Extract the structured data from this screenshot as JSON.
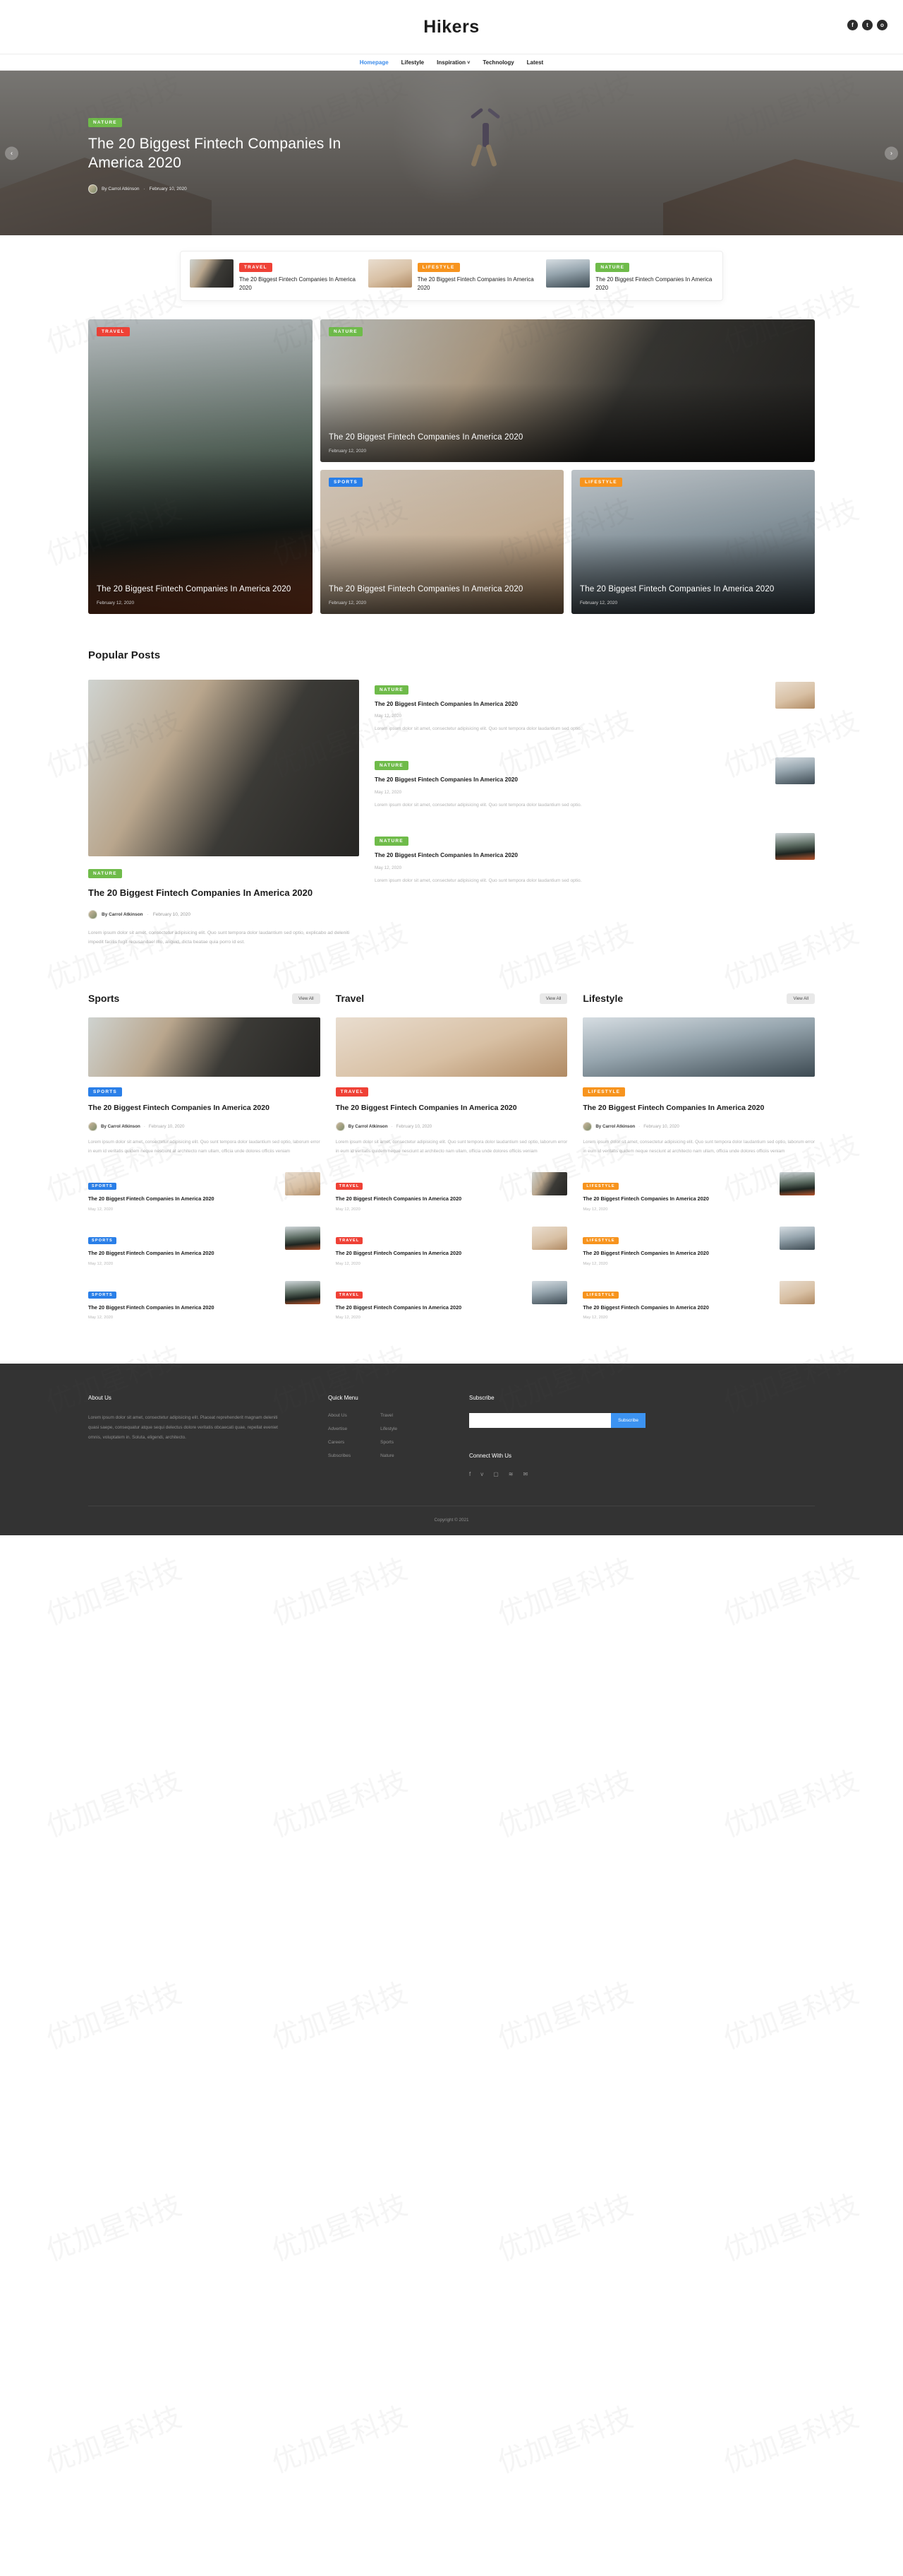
{
  "header": {
    "logo": "Hikers",
    "social_top": [
      {
        "name": "facebook-icon",
        "glyph": "f"
      },
      {
        "name": "twitter-icon",
        "glyph": "t"
      },
      {
        "name": "instagram-icon",
        "glyph": "o"
      }
    ],
    "nav": [
      {
        "label": "Homepage",
        "active": true
      },
      {
        "label": "Lifestyle",
        "active": false
      },
      {
        "label": "Inspiration",
        "active": false,
        "caret": "˅"
      },
      {
        "label": "Technology",
        "active": false
      },
      {
        "label": "Latest",
        "active": false
      }
    ]
  },
  "hero": {
    "badge": "NATURE",
    "title": "The 20 Biggest Fintech Companies In America 2020",
    "author": "By Carrol Atkinson",
    "separator": "·",
    "date": "February 10, 2020",
    "prev": "‹",
    "next": "›"
  },
  "strip": [
    {
      "badge": "TRAVEL",
      "badge_class": "b-travel",
      "title": "The 20 Biggest Fintech Companies In America 2020",
      "thumb": "t-office"
    },
    {
      "badge": "LIFESTYLE",
      "badge_class": "b-lifestyle",
      "title": "The 20 Biggest Fintech Companies In America 2020",
      "thumb": "t-jump"
    },
    {
      "badge": "NATURE",
      "badge_class": "b-nature",
      "title": "The 20 Biggest Fintech Companies In America 2020",
      "thumb": "t-cliff"
    }
  ],
  "featured": {
    "big": {
      "badge": "TRAVEL",
      "title": "The 20 Biggest Fintech Companies In America 2020",
      "date": "February 12, 2020"
    },
    "wide": {
      "badge": "NATURE",
      "title": "The 20 Biggest Fintech Companies In America 2020",
      "date": "February 12, 2020"
    },
    "small1": {
      "badge": "SPORTS",
      "title": "The 20 Biggest Fintech Companies In America 2020",
      "date": "February 12, 2020"
    },
    "small2": {
      "badge": "LIFESTYLE",
      "title": "The 20 Biggest Fintech Companies In America 2020",
      "date": "February 12, 2020"
    }
  },
  "popular": {
    "heading": "Popular Posts",
    "main": {
      "badge": "NATURE",
      "title": "The 20 Biggest Fintech Companies In America 2020",
      "author": "By Carrol Atkinson",
      "date": "February 10, 2020",
      "excerpt": "Lorem ipsum dolor sit amet, consectetur adipisicing elit. Quo sunt tempora dolor laudantium sed optio, explicabo ad deleniti impedit facilis fugit recusandae! Illo, aliquid, dicta beatae quia porro id est."
    },
    "items": [
      {
        "badge": "NATURE",
        "title": "The 20 Biggest Fintech Companies In America 2020",
        "date": "May 12, 2020",
        "excerpt": "Lorem ipsum dolor sit amet, consectetur adipisicing elit. Quo sunt tempora dolor laudantium sed optio.",
        "thumb": "t-jump"
      },
      {
        "badge": "NATURE",
        "title": "The 20 Biggest Fintech Companies In America 2020",
        "date": "May 12, 2020",
        "excerpt": "Lorem ipsum dolor sit amet, consectetur adipisicing elit. Quo sunt tempora dolor laudantium sed optio.",
        "thumb": "t-cliff"
      },
      {
        "badge": "NATURE",
        "title": "The 20 Biggest Fintech Companies In America 2020",
        "date": "May 12, 2020",
        "excerpt": "Lorem ipsum dolor sit amet, consectetur adipisicing elit. Quo sunt tempora dolor laudantium sed optio.",
        "thumb": "t-kayak"
      }
    ]
  },
  "categories": [
    {
      "name": "Sports",
      "view_all": "View All",
      "badge": "SPORTS",
      "badge_class": "b-sports",
      "img": "t-office",
      "title": "The 20 Biggest Fintech Companies In America 2020",
      "author": "By Carrol Atkinson",
      "date": "February 10, 2020",
      "excerpt": "Lorem ipsum dolor sit amet, consectetur adipisicing elit. Quo sunt tempora dolor laudantium sed optio, laborum error in eum id veritatis quidem neque nesciunt at architecto nam ullam, officia unde dolores officiis veniam",
      "items": [
        {
          "badge": "SPORTS",
          "title": "The 20 Biggest Fintech Companies In America 2020",
          "date": "May 12, 2020",
          "thumb": "t-jump"
        },
        {
          "badge": "SPORTS",
          "title": "The 20 Biggest Fintech Companies In America 2020",
          "date": "May 12, 2020",
          "thumb": "t-kayak"
        },
        {
          "badge": "SPORTS",
          "title": "The 20 Biggest Fintech Companies In America 2020",
          "date": "May 12, 2020",
          "thumb": "t-kayak"
        }
      ]
    },
    {
      "name": "Travel",
      "view_all": "View All",
      "badge": "TRAVEL",
      "badge_class": "b-travel",
      "img": "t-jump",
      "title": "The 20 Biggest Fintech Companies In America 2020",
      "author": "By Carrol Atkinson",
      "date": "February 10, 2020",
      "excerpt": "Lorem ipsum dolor sit amet, consectetur adipisicing elit. Quo sunt tempora dolor laudantium sed optio, laborum error in eum id veritatis quidem neque nesciunt at architecto nam ullam, officia unde dolores officiis veniam",
      "items": [
        {
          "badge": "TRAVEL",
          "title": "The 20 Biggest Fintech Companies In America 2020",
          "date": "May 12, 2020",
          "thumb": "t-office"
        },
        {
          "badge": "TRAVEL",
          "title": "The 20 Biggest Fintech Companies In America 2020",
          "date": "May 12, 2020",
          "thumb": "t-jump"
        },
        {
          "badge": "TRAVEL",
          "title": "The 20 Biggest Fintech Companies In America 2020",
          "date": "May 12, 2020",
          "thumb": "t-cliff"
        }
      ]
    },
    {
      "name": "Lifestyle",
      "view_all": "View All",
      "badge": "LIFESTYLE",
      "badge_class": "b-lifestyle",
      "img": "t-cliff",
      "title": "The 20 Biggest Fintech Companies In America 2020",
      "author": "By Carrol Atkinson",
      "date": "February 10, 2020",
      "excerpt": "Lorem ipsum dolor sit amet, consectetur adipisicing elit. Quo sunt tempora dolor laudantium sed optio, laborum error in eum id veritatis quidem neque nesciunt at architecto nam ullam, officia unde dolores officiis veniam",
      "items": [
        {
          "badge": "LIFESTYLE",
          "title": "The 20 Biggest Fintech Companies In America 2020",
          "date": "May 12, 2020",
          "thumb": "t-kayak"
        },
        {
          "badge": "LIFESTYLE",
          "title": "The 20 Biggest Fintech Companies In America 2020",
          "date": "May 12, 2020",
          "thumb": "t-cliff"
        },
        {
          "badge": "LIFESTYLE",
          "title": "The 20 Biggest Fintech Companies In America 2020",
          "date": "May 12, 2020",
          "thumb": "t-jump"
        }
      ]
    }
  ],
  "footer": {
    "about_heading": "About Us",
    "about_text": "Lorem ipsum dolor sit amet, consectetur adipisicing elit. Placeat reprehenderit magnam deleniti quasi saepe, consequatur atque sequi delectus dolore veritatis obcaecati quae, repellat eveniet omnis, voluptatem in. Soluta, eligendi, architecto.",
    "menu_heading": "Quick Menu",
    "menu_col1": [
      "About Us",
      "Advertise",
      "Careers",
      "Subscribes"
    ],
    "menu_col2": [
      "Travel",
      "Lifestyle",
      "Sports",
      "Nature"
    ],
    "subscribe_heading": "Subscribe",
    "subscribe_placeholder": "",
    "subscribe_value": "",
    "subscribe_button": "Subscribe",
    "connect_heading": "Connect With Us",
    "social": [
      {
        "name": "facebook-icon",
        "glyph": "f"
      },
      {
        "name": "twitter-icon",
        "glyph": "ᴠ"
      },
      {
        "name": "instagram-icon",
        "glyph": "▢"
      },
      {
        "name": "rss-icon",
        "glyph": "≋"
      },
      {
        "name": "email-icon",
        "glyph": "✉"
      }
    ],
    "copyright": "Copyright © 2021"
  },
  "watermark": "优加星科技"
}
